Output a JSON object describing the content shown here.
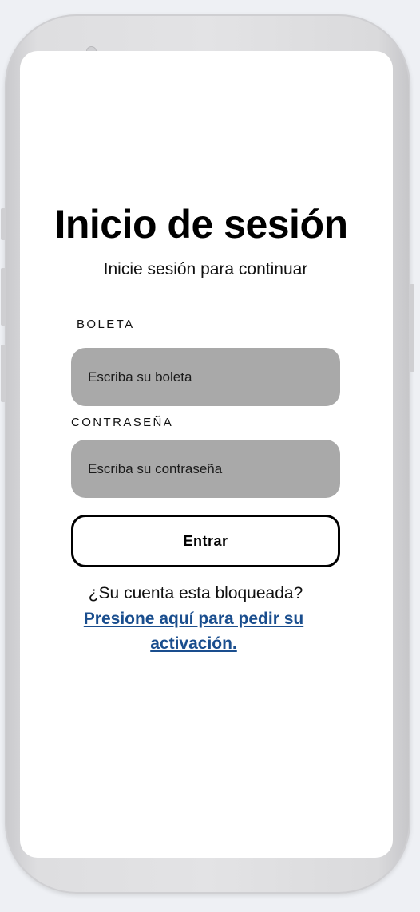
{
  "colors": {
    "background": "#eef0f4",
    "screen": "#ffffff",
    "input_fill": "#a9a9a9",
    "link": "#1a4e8e",
    "button_border": "#000000"
  },
  "login": {
    "title": "Inicio de sesión",
    "subtitle": "Inicie sesión para continuar",
    "boleta": {
      "label": "BOLETA",
      "placeholder": "Escriba su boleta",
      "value": ""
    },
    "password": {
      "label": "CONTRASEÑA",
      "placeholder": "Escriba su contraseña",
      "value": ""
    },
    "submit_label": "Entrar",
    "blocked_question": "¿Su cuenta esta bloqueada?",
    "activation_link": "Presione aquí para pedir su activación."
  }
}
